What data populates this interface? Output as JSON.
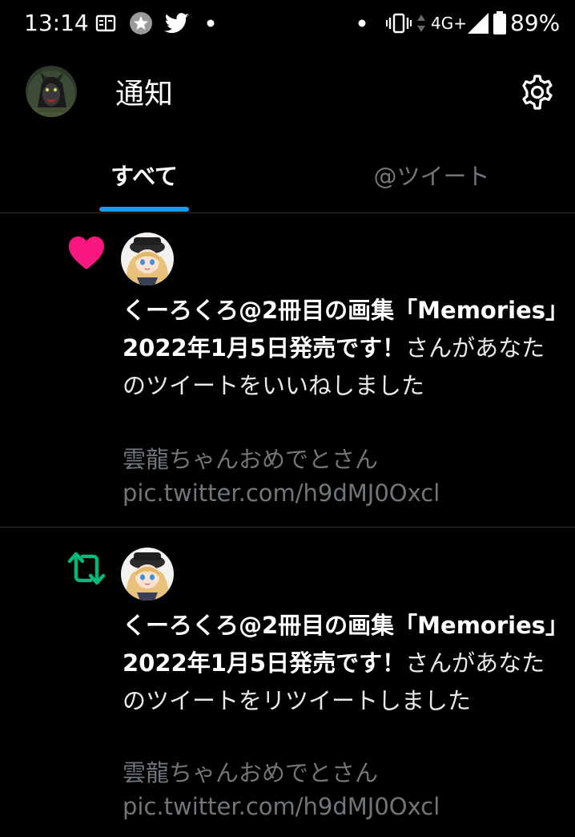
{
  "status_bar": {
    "time": "13:14",
    "network": "4G+",
    "battery": "89%",
    "icons": [
      "book-icon",
      "star-badge-icon",
      "twitter-bird-icon",
      "dot-icon",
      "vibrate-icon",
      "data-arrows-icon",
      "signal-icon",
      "battery-icon"
    ]
  },
  "header": {
    "title": "通知",
    "icons": [
      "avatar",
      "gear-icon"
    ]
  },
  "tabs": [
    {
      "label": "すべて",
      "active": true
    },
    {
      "label": "@ツイート",
      "active": false
    }
  ],
  "colors": {
    "background": "#000000",
    "accent": "#1d9bf0",
    "like": "#f91880",
    "retweet": "#00ba7c",
    "secondary_text": "#71767b"
  },
  "notifications": [
    {
      "type_icon": "heart-icon",
      "user": "くーろくろ@2冊目の画集「Memories」2022年1月5日発売です！",
      "action": "さんがあなたのツイートをいいねしました",
      "preview_text": "雲龍ちゃんおめでとさん",
      "preview_link": "pic.twitter.com/h9dMJ0Oxcl"
    },
    {
      "type_icon": "retweet-icon",
      "user": "くーろくろ@2冊目の画集「Memories」2022年1月5日発売です！",
      "action": "さんがあなたのツイートをリツイートしました",
      "preview_text": "雲龍ちゃんおめでとさん",
      "preview_link": "pic.twitter.com/h9dMJ0Oxcl"
    }
  ]
}
